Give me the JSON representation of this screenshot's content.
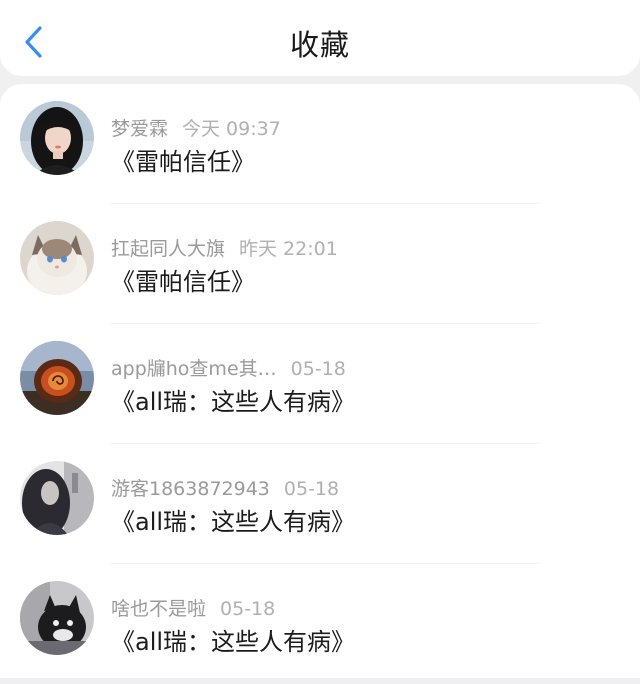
{
  "header": {
    "title": "收藏",
    "back_icon": "chevron-left-icon",
    "accent": "#3a8cf0"
  },
  "favorites": [
    {
      "user": "梦爱霖",
      "time": "今天 09:37",
      "title": "《雷帕信任》"
    },
    {
      "user": "扛起同人大旗",
      "time": "昨天 22:01",
      "title": "《雷帕信任》"
    },
    {
      "user": "app牖ho查me其…",
      "time": "05-18",
      "title": "《all瑞：这些人有病》"
    },
    {
      "user": "游客1863872943",
      "time": "05-18",
      "title": "《all瑞：这些人有病》"
    },
    {
      "user": "啥也不是啦",
      "time": "05-18",
      "title": "《all瑞：这些人有病》"
    }
  ]
}
